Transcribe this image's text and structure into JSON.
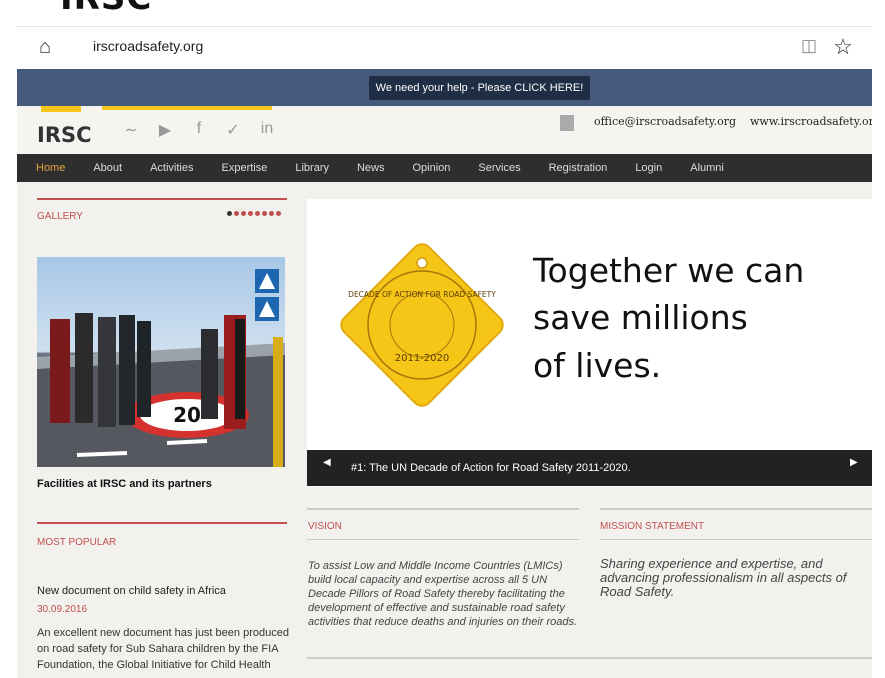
{
  "logo_text": "IRSC",
  "browser": {
    "url": "irscroadsafety.org",
    "home_icon": "home-icon",
    "reader_icon": "reading-view-icon",
    "favorite_icon": "star-icon"
  },
  "banner": {
    "label": "We need your help - Please CLICK HERE!"
  },
  "header": {
    "brand": "IRSC",
    "email": "office@irscroadsafety.org",
    "website": "www.irscroadsafety.org",
    "social_icons": [
      "rss-icon",
      "youtube-icon",
      "facebook-icon",
      "twitter-icon",
      "linkedin-icon"
    ]
  },
  "nav": {
    "items": [
      {
        "label": "Home",
        "active": true
      },
      {
        "label": "About"
      },
      {
        "label": "Activities"
      },
      {
        "label": "Expertise"
      },
      {
        "label": "Library"
      },
      {
        "label": "News"
      },
      {
        "label": "Opinion"
      },
      {
        "label": "Services"
      },
      {
        "label": "Registration"
      },
      {
        "label": "Login"
      },
      {
        "label": "Alumni"
      }
    ]
  },
  "gallery": {
    "title": "GALLERY",
    "caption": "Facilities at IRSC and its partners",
    "speed_sign": "20"
  },
  "popular": {
    "title": "MOST POPULAR",
    "article_title": "New document on child safety in Africa",
    "article_date": "30.09.2016",
    "article_excerpt": "An excellent new document has just been produced on road safety for Sub Sahara children by the FIA Foundation, the Global Initiative for Child Health"
  },
  "slider": {
    "badge_text": "DECADE OF ACTION FOR ROAD SAFETY",
    "badge_years": "2011-2020",
    "headline_1": "Together we can",
    "headline_2": "save millions",
    "headline_3": "of lives.",
    "caption": "#1: The UN Decade of Action for Road Safety 2011-2020."
  },
  "vision": {
    "title": "VISION",
    "text": "To assist Low and Middle Income Countries (LMICs) build local capacity and expertise across all 5 UN Decade Pillors of Road Safety thereby facilitating the development of effective and sustainable road safety activities that reduce deaths and injuries on their roads."
  },
  "mission": {
    "title": "MISSION STATEMENT",
    "text": "Sharing experience and expertise, and advancing professionalism in all aspects of Road Safety."
  },
  "colors": {
    "accent_red": "#c0504d",
    "banner_blue": "#465b7c",
    "nav_dark": "#2e2e2e",
    "badge_yellow": "#f5c518"
  }
}
